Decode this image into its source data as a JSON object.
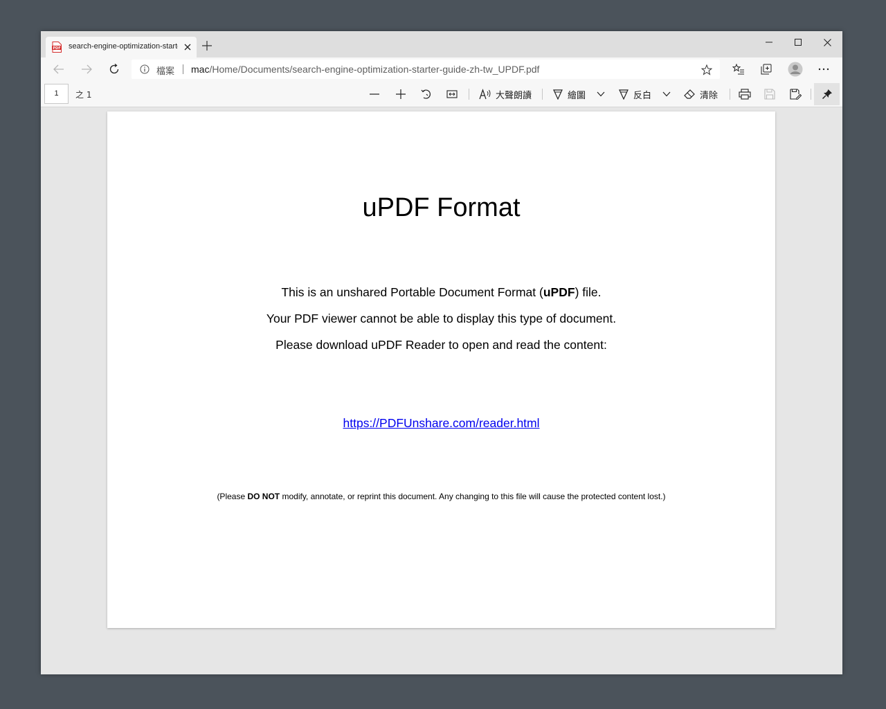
{
  "browser": {
    "tab": {
      "title": "search-engine-optimization-starter-guide-zh-tw_UPDF.pdf",
      "favicon_text": "PDF"
    },
    "address": {
      "site_label": "檔案",
      "url_host": "mac",
      "url_path": "/Home/Documents/search-engine-optimization-starter-guide-zh-tw_UPDF.pdf"
    }
  },
  "pdf_toolbar": {
    "page_number": "1",
    "page_total": "之 1",
    "read_aloud_label": "大聲朗讀",
    "draw_label": "繪圖",
    "highlight_label": "反白",
    "erase_label": "清除"
  },
  "document": {
    "title": "uPDF Format",
    "line1_pre": "This is an unshared Portable Document Format (",
    "line1_bold": "uPDF",
    "line1_post": ") file.",
    "line2": "Your PDF viewer cannot be able to display this type of document.",
    "line3": "Please download uPDF Reader to open and read the content:",
    "link": "https://PDFUnshare.com/reader.html",
    "note_pre": "(Please ",
    "note_bold": "DO NOT",
    "note_post": " modify, annotate, or reprint this document. Any changing to this file will cause the protected content lost.)"
  },
  "colors": {
    "desktop": "#4b535b",
    "link": "#0000ee",
    "pdf_icon_red": "#d42b2b"
  }
}
